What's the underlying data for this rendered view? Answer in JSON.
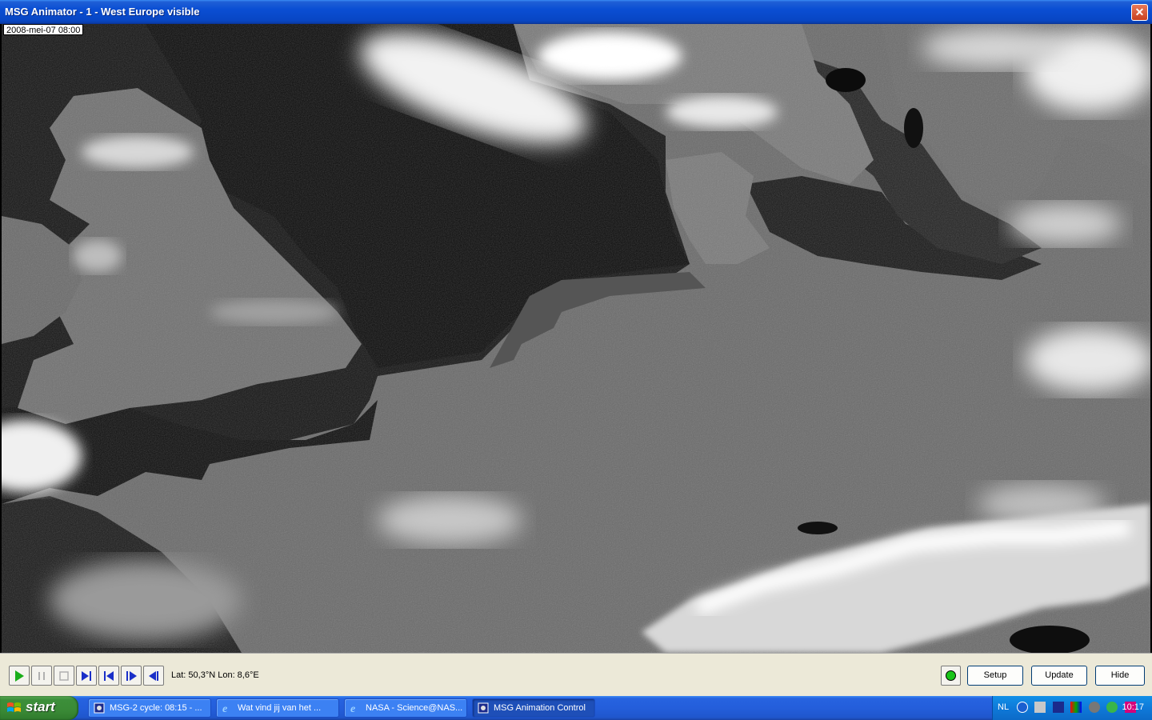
{
  "window": {
    "title": "MSG Animator - 1 - West Europe visible",
    "close_label": "✕"
  },
  "viewport": {
    "timestamp": "2008-mei-07 08:00"
  },
  "controls": {
    "lat_lon": "Lat: 50,3°N  Lon: 8,6°E",
    "setup_label": "Setup",
    "update_label": "Update",
    "hide_label": "Hide",
    "indicator_color": "#19c419"
  },
  "taskbar": {
    "start_label": "start",
    "tasks": [
      {
        "label": "MSG-2 cycle: 08:15 - ...",
        "icon": "msg-app-icon"
      },
      {
        "label": "Wat vind jij van het ...",
        "icon": "ie-icon"
      },
      {
        "label": "NASA - Science@NAS...",
        "icon": "ie-icon"
      },
      {
        "label": "MSG Animation Control",
        "icon": "msg-app-icon"
      }
    ],
    "tray": {
      "language": "NL",
      "clock": "10:17"
    }
  }
}
